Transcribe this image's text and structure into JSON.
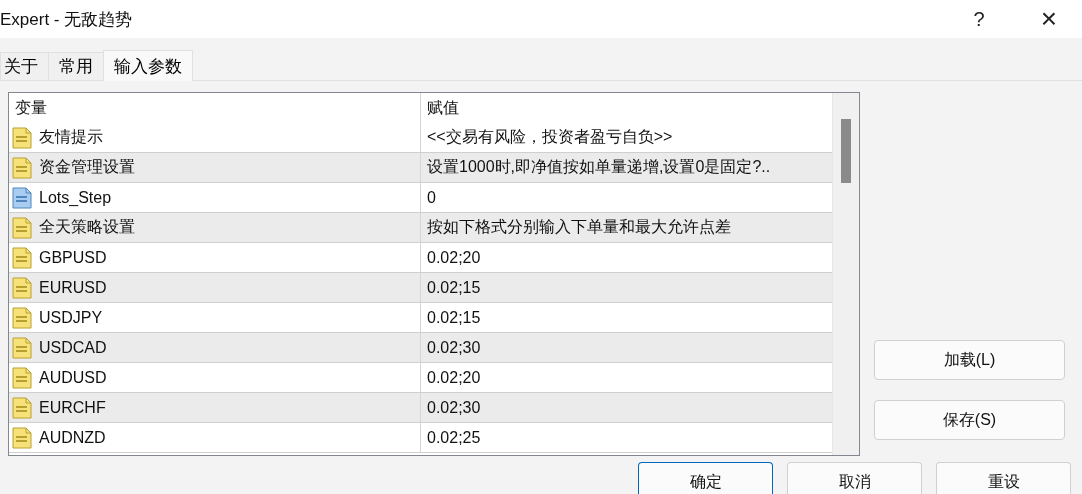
{
  "window": {
    "title": "Expert - 无敌趋势",
    "help": "?",
    "close": "×"
  },
  "tabs": [
    {
      "label": "关于",
      "selected": false
    },
    {
      "label": "常用",
      "selected": false
    },
    {
      "label": "输入参数",
      "selected": true
    }
  ],
  "table": {
    "columns": [
      "变量",
      "赋值"
    ],
    "rows": [
      {
        "kind": "string",
        "name": "友情提示",
        "value": "<<交易有风险，投资者盈亏自负>>"
      },
      {
        "kind": "string",
        "name": "资金管理设置",
        "value": "设置1000时,即净值按如单量递增,设置0是固定?.."
      },
      {
        "kind": "number",
        "name": "Lots_Step",
        "value": "0"
      },
      {
        "kind": "string",
        "name": "全天策略设置",
        "value": "按如下格式分别输入下单量和最大允许点差"
      },
      {
        "kind": "string",
        "name": "GBPUSD",
        "value": "0.02;20"
      },
      {
        "kind": "string",
        "name": "EURUSD",
        "value": "0.02;15"
      },
      {
        "kind": "string",
        "name": "USDJPY",
        "value": "0.02;15"
      },
      {
        "kind": "string",
        "name": "USDCAD",
        "value": "0.02;30"
      },
      {
        "kind": "string",
        "name": "AUDUSD",
        "value": "0.02;20"
      },
      {
        "kind": "string",
        "name": "EURCHF",
        "value": "0.02;30"
      },
      {
        "kind": "string",
        "name": "AUDNZD",
        "value": "0.02;25"
      }
    ]
  },
  "side_buttons": [
    "加载(L)",
    "保存(S)"
  ],
  "buttons": [
    {
      "label": "确定",
      "default": true
    },
    {
      "label": "取消",
      "default": false
    },
    {
      "label": "重设",
      "default": false
    }
  ]
}
